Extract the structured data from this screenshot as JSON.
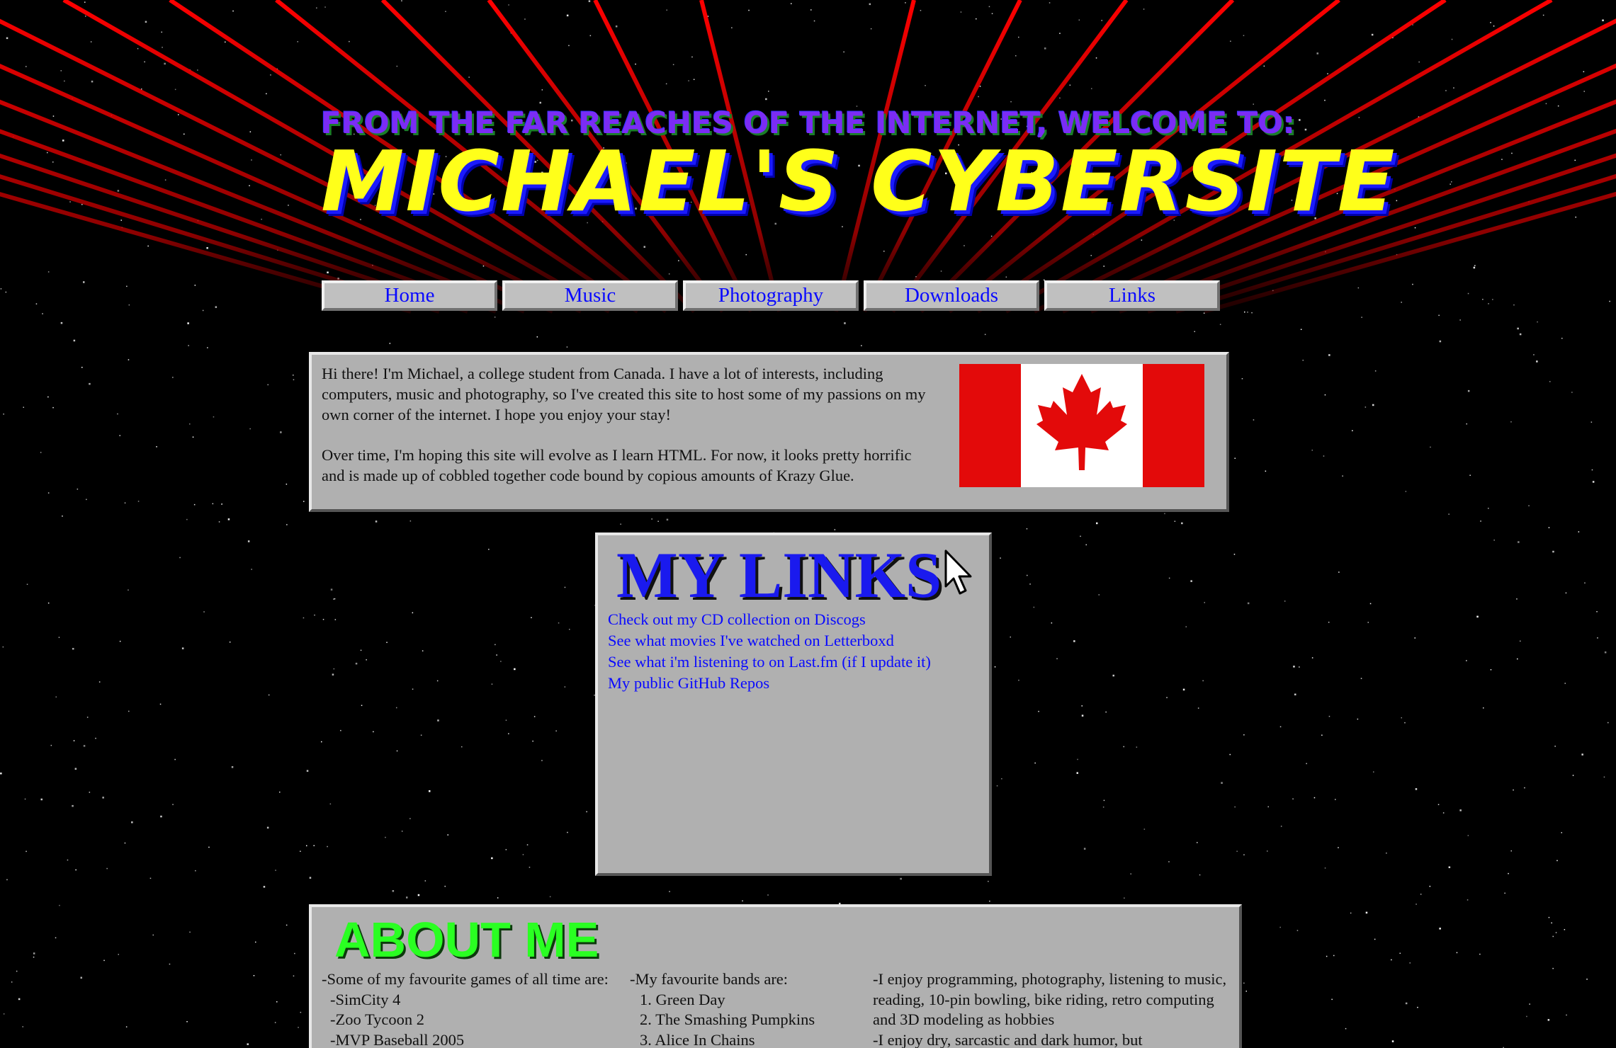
{
  "header": {
    "tagline": "FROM THE FAR REACHES OF THE INTERNET, WELCOME TO:",
    "title": "MICHAEL'S CYBERSITE"
  },
  "nav": {
    "items": [
      {
        "label": "Home"
      },
      {
        "label": "Music"
      },
      {
        "label": "Photography"
      },
      {
        "label": "Downloads"
      },
      {
        "label": "Links"
      }
    ]
  },
  "intro": {
    "paragraph1": "Hi there! I'm Michael, a college student from Canada. I have a lot of interests, including computers, music and photography, so I've created this site to host some of my passions on my own corner of the internet. I hope you enjoy your stay!",
    "paragraph2": "Over time, I'm hoping this site will evolve as I learn HTML. For now, it looks pretty horrific and is made up of cobbled together code bound by copious amounts of Krazy Glue.",
    "flag_icon": "canada-flag-icon"
  },
  "links_panel": {
    "heading": "MY LINKS",
    "links": [
      {
        "label": "Check out my CD collection on Discogs"
      },
      {
        "label": "See what movies I've watched on Letterboxd"
      },
      {
        "label": "See what i'm listening to on Last.fm (if I update it)"
      },
      {
        "label": "My public GitHub Repos"
      }
    ]
  },
  "about": {
    "heading": "ABOUT ME",
    "games_title": "-Some of my favourite games of all time are:",
    "games": [
      "-SimCity 4",
      "-Zoo Tycoon 2",
      "-MVP Baseball 2005"
    ],
    "bands_title": "-My favourite bands are:",
    "bands": [
      "1. Green Day",
      "2. The Smashing Pumpkins",
      "3. Alice In Chains"
    ],
    "hobbies": "-I enjoy programming, photography, listening to music, reading, 10-pin bowling, bike riding, retro computing and 3D modeling as hobbies",
    "humor": "-I enjoy dry, sarcastic and dark humor, but"
  },
  "colors": {
    "grid": "#ff0000",
    "panel": "#b0b0b0",
    "link": "#0a0aff",
    "title_yellow": "#ffff1a",
    "about_green": "#2aff22"
  }
}
